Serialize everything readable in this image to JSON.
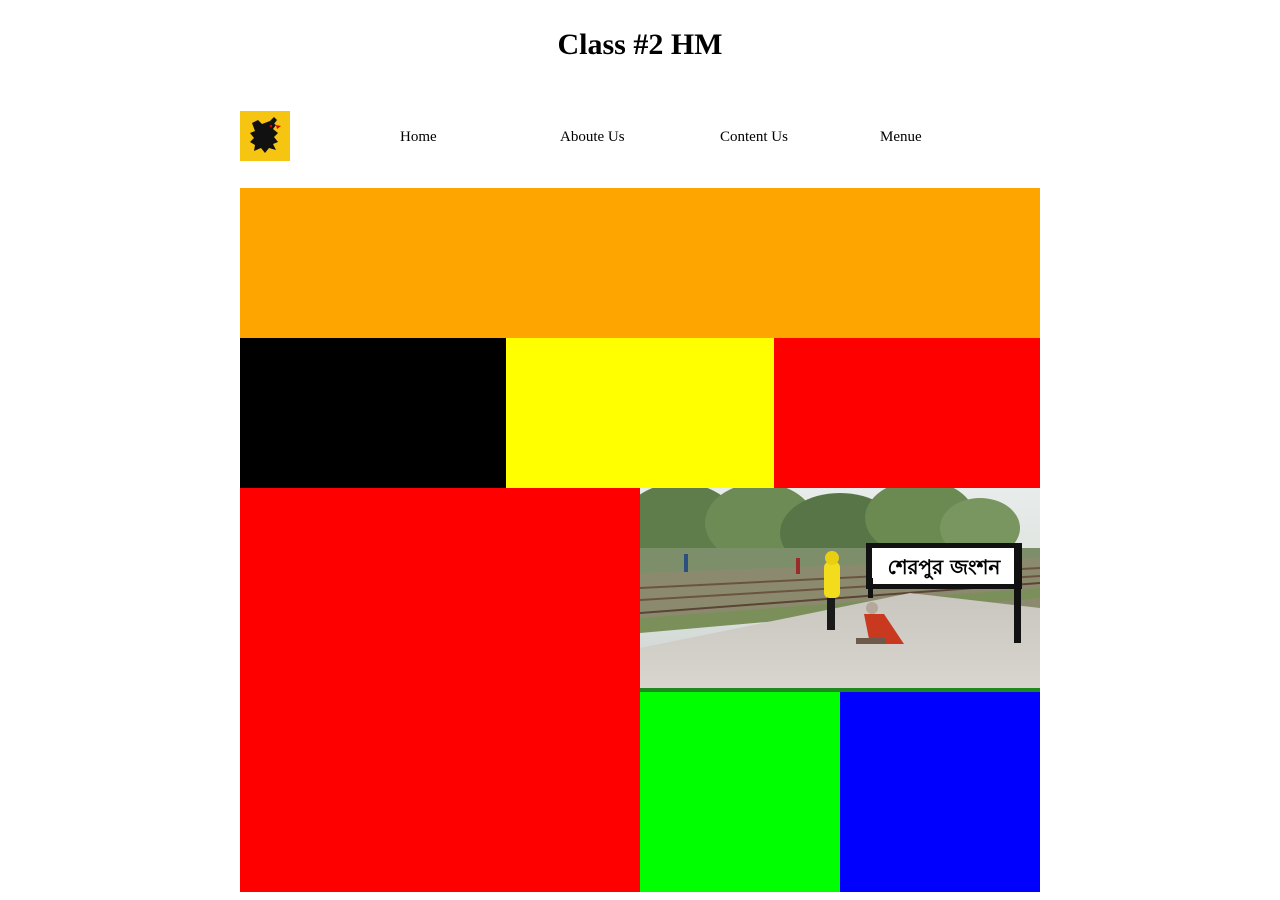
{
  "page": {
    "title": "Class #2 HM"
  },
  "logo": {
    "icon": "flemish-lion-flag-icon",
    "background": "#f6c511"
  },
  "nav": {
    "items": [
      {
        "label": "Home"
      },
      {
        "label": "Aboute Us"
      },
      {
        "label": "Content Us"
      },
      {
        "label": "Menue"
      }
    ]
  },
  "blocks": {
    "orange": "#ffa500",
    "black": "#000000",
    "yellow": "#ffff00",
    "red": "#ff0000",
    "green": "#00ff00",
    "blue": "#0000ff",
    "strip": "#1e8a1e"
  },
  "photo": {
    "sign_text": "শেরপুর জংশন"
  }
}
